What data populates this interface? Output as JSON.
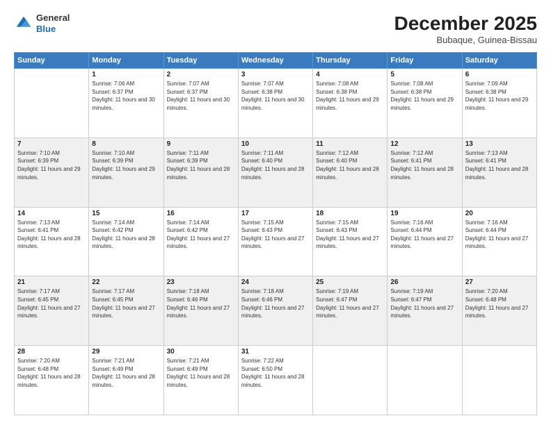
{
  "logo": {
    "general": "General",
    "blue": "Blue"
  },
  "title": "December 2025",
  "subtitle": "Bubaque, Guinea-Bissau",
  "days_header": [
    "Sunday",
    "Monday",
    "Tuesday",
    "Wednesday",
    "Thursday",
    "Friday",
    "Saturday"
  ],
  "weeks": [
    [
      {
        "num": "",
        "sunrise": "",
        "sunset": "",
        "daylight": ""
      },
      {
        "num": "1",
        "sunrise": "Sunrise: 7:06 AM",
        "sunset": "Sunset: 6:37 PM",
        "daylight": "Daylight: 11 hours and 30 minutes."
      },
      {
        "num": "2",
        "sunrise": "Sunrise: 7:07 AM",
        "sunset": "Sunset: 6:37 PM",
        "daylight": "Daylight: 11 hours and 30 minutes."
      },
      {
        "num": "3",
        "sunrise": "Sunrise: 7:07 AM",
        "sunset": "Sunset: 6:38 PM",
        "daylight": "Daylight: 11 hours and 30 minutes."
      },
      {
        "num": "4",
        "sunrise": "Sunrise: 7:08 AM",
        "sunset": "Sunset: 6:38 PM",
        "daylight": "Daylight: 11 hours and 29 minutes."
      },
      {
        "num": "5",
        "sunrise": "Sunrise: 7:08 AM",
        "sunset": "Sunset: 6:38 PM",
        "daylight": "Daylight: 11 hours and 29 minutes."
      },
      {
        "num": "6",
        "sunrise": "Sunrise: 7:09 AM",
        "sunset": "Sunset: 6:38 PM",
        "daylight": "Daylight: 11 hours and 29 minutes."
      }
    ],
    [
      {
        "num": "7",
        "sunrise": "Sunrise: 7:10 AM",
        "sunset": "Sunset: 6:39 PM",
        "daylight": "Daylight: 11 hours and 29 minutes."
      },
      {
        "num": "8",
        "sunrise": "Sunrise: 7:10 AM",
        "sunset": "Sunset: 6:39 PM",
        "daylight": "Daylight: 11 hours and 29 minutes."
      },
      {
        "num": "9",
        "sunrise": "Sunrise: 7:11 AM",
        "sunset": "Sunset: 6:39 PM",
        "daylight": "Daylight: 11 hours and 28 minutes."
      },
      {
        "num": "10",
        "sunrise": "Sunrise: 7:11 AM",
        "sunset": "Sunset: 6:40 PM",
        "daylight": "Daylight: 11 hours and 28 minutes."
      },
      {
        "num": "11",
        "sunrise": "Sunrise: 7:12 AM",
        "sunset": "Sunset: 6:40 PM",
        "daylight": "Daylight: 11 hours and 28 minutes."
      },
      {
        "num": "12",
        "sunrise": "Sunrise: 7:12 AM",
        "sunset": "Sunset: 6:41 PM",
        "daylight": "Daylight: 11 hours and 28 minutes."
      },
      {
        "num": "13",
        "sunrise": "Sunrise: 7:13 AM",
        "sunset": "Sunset: 6:41 PM",
        "daylight": "Daylight: 11 hours and 28 minutes."
      }
    ],
    [
      {
        "num": "14",
        "sunrise": "Sunrise: 7:13 AM",
        "sunset": "Sunset: 6:41 PM",
        "daylight": "Daylight: 11 hours and 28 minutes."
      },
      {
        "num": "15",
        "sunrise": "Sunrise: 7:14 AM",
        "sunset": "Sunset: 6:42 PM",
        "daylight": "Daylight: 11 hours and 28 minutes."
      },
      {
        "num": "16",
        "sunrise": "Sunrise: 7:14 AM",
        "sunset": "Sunset: 6:42 PM",
        "daylight": "Daylight: 11 hours and 27 minutes."
      },
      {
        "num": "17",
        "sunrise": "Sunrise: 7:15 AM",
        "sunset": "Sunset: 6:43 PM",
        "daylight": "Daylight: 11 hours and 27 minutes."
      },
      {
        "num": "18",
        "sunrise": "Sunrise: 7:15 AM",
        "sunset": "Sunset: 6:43 PM",
        "daylight": "Daylight: 11 hours and 27 minutes."
      },
      {
        "num": "19",
        "sunrise": "Sunrise: 7:16 AM",
        "sunset": "Sunset: 6:44 PM",
        "daylight": "Daylight: 11 hours and 27 minutes."
      },
      {
        "num": "20",
        "sunrise": "Sunrise: 7:16 AM",
        "sunset": "Sunset: 6:44 PM",
        "daylight": "Daylight: 11 hours and 27 minutes."
      }
    ],
    [
      {
        "num": "21",
        "sunrise": "Sunrise: 7:17 AM",
        "sunset": "Sunset: 6:45 PM",
        "daylight": "Daylight: 11 hours and 27 minutes."
      },
      {
        "num": "22",
        "sunrise": "Sunrise: 7:17 AM",
        "sunset": "Sunset: 6:45 PM",
        "daylight": "Daylight: 11 hours and 27 minutes."
      },
      {
        "num": "23",
        "sunrise": "Sunrise: 7:18 AM",
        "sunset": "Sunset: 6:46 PM",
        "daylight": "Daylight: 11 hours and 27 minutes."
      },
      {
        "num": "24",
        "sunrise": "Sunrise: 7:18 AM",
        "sunset": "Sunset: 6:46 PM",
        "daylight": "Daylight: 11 hours and 27 minutes."
      },
      {
        "num": "25",
        "sunrise": "Sunrise: 7:19 AM",
        "sunset": "Sunset: 6:47 PM",
        "daylight": "Daylight: 11 hours and 27 minutes."
      },
      {
        "num": "26",
        "sunrise": "Sunrise: 7:19 AM",
        "sunset": "Sunset: 6:47 PM",
        "daylight": "Daylight: 11 hours and 27 minutes."
      },
      {
        "num": "27",
        "sunrise": "Sunrise: 7:20 AM",
        "sunset": "Sunset: 6:48 PM",
        "daylight": "Daylight: 11 hours and 27 minutes."
      }
    ],
    [
      {
        "num": "28",
        "sunrise": "Sunrise: 7:20 AM",
        "sunset": "Sunset: 6:48 PM",
        "daylight": "Daylight: 11 hours and 28 minutes."
      },
      {
        "num": "29",
        "sunrise": "Sunrise: 7:21 AM",
        "sunset": "Sunset: 6:49 PM",
        "daylight": "Daylight: 11 hours and 28 minutes."
      },
      {
        "num": "30",
        "sunrise": "Sunrise: 7:21 AM",
        "sunset": "Sunset: 6:49 PM",
        "daylight": "Daylight: 11 hours and 28 minutes."
      },
      {
        "num": "31",
        "sunrise": "Sunrise: 7:22 AM",
        "sunset": "Sunset: 6:50 PM",
        "daylight": "Daylight: 11 hours and 28 minutes."
      },
      {
        "num": "",
        "sunrise": "",
        "sunset": "",
        "daylight": ""
      },
      {
        "num": "",
        "sunrise": "",
        "sunset": "",
        "daylight": ""
      },
      {
        "num": "",
        "sunrise": "",
        "sunset": "",
        "daylight": ""
      }
    ]
  ]
}
